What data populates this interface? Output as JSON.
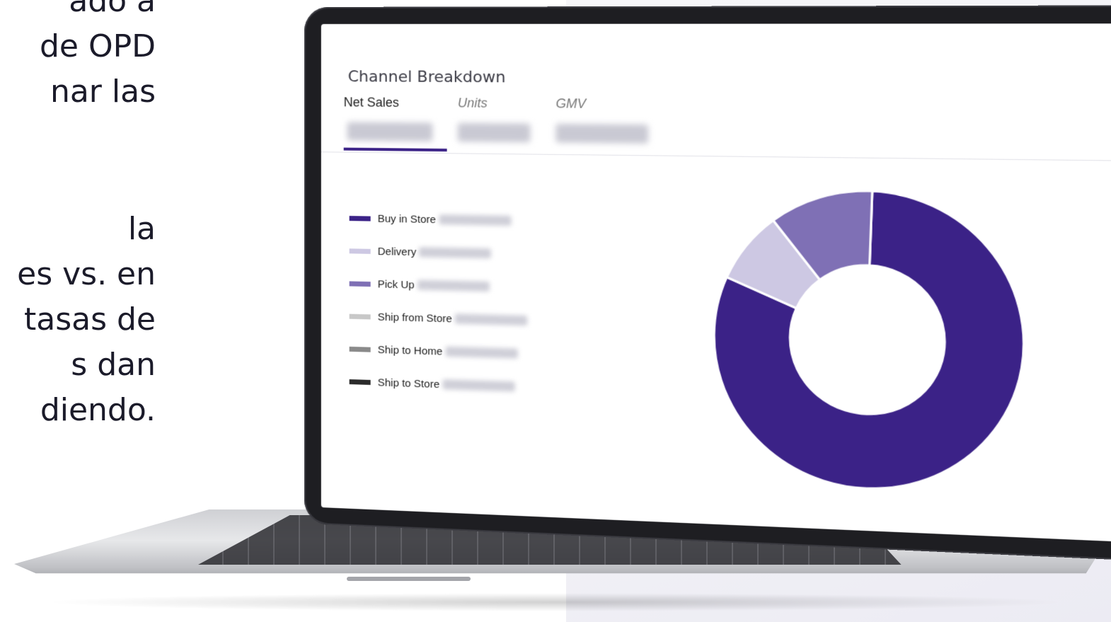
{
  "side_text": {
    "lines": [
      "ado a",
      "de OPD",
      "nar las",
      "la",
      "es vs. en",
      "tasas de",
      "s dan",
      "diendo."
    ]
  },
  "dashboard": {
    "title": "Channel Breakdown",
    "tabs": [
      {
        "label": "Net Sales",
        "active": true
      },
      {
        "label": "Units",
        "active": false
      },
      {
        "label": "GMV",
        "active": false
      }
    ],
    "legend": [
      {
        "label": "Buy in Store",
        "color": "#3b2287"
      },
      {
        "label": "Delivery",
        "color": "#cdc8e3"
      },
      {
        "label": "Pick Up",
        "color": "#7f70b5"
      },
      {
        "label": "Ship from Store",
        "color": "#c8c8c8"
      },
      {
        "label": "Ship to Home",
        "color": "#8a8a8a"
      },
      {
        "label": "Ship to Store",
        "color": "#2b2b2b"
      }
    ]
  },
  "chart_data": {
    "type": "pie",
    "categories": [
      "Buy in Store",
      "Delivery",
      "Pick Up"
    ],
    "values": [
      81,
      8,
      11
    ],
    "colors": [
      "#3b2287",
      "#cdc8e3",
      "#7f70b5"
    ]
  }
}
